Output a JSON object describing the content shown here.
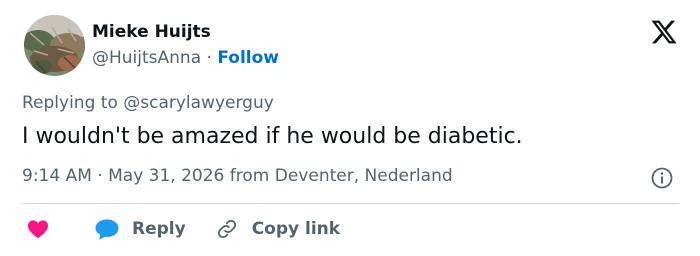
{
  "user": {
    "display_name": "Mieke Huijts",
    "handle": "@HuijtsAnna",
    "separator": "·",
    "follow_label": "Follow"
  },
  "tweet": {
    "replying_prefix": "Replying to",
    "replying_to": "@scarylawyerguy",
    "text": "I wouldn't be amazed if he would be diabetic.",
    "time": "9:14 AM",
    "date": "May 31, 2026",
    "source_prefix": "from",
    "location": "Deventer, Nederland"
  },
  "actions": {
    "reply_label": "Reply",
    "copy_link_label": "Copy link"
  },
  "icons": {
    "logo": "x-logo-icon",
    "info": "info-icon",
    "like": "heart-icon",
    "reply": "speech-bubble-icon",
    "copy": "link-icon"
  },
  "colors": {
    "text_primary": "#0f1419",
    "text_secondary": "#536471",
    "link_blue": "#006fd6",
    "heart_pink": "#f91880",
    "reply_blue": "#1d9bf0",
    "divider": "#cfd9de"
  }
}
